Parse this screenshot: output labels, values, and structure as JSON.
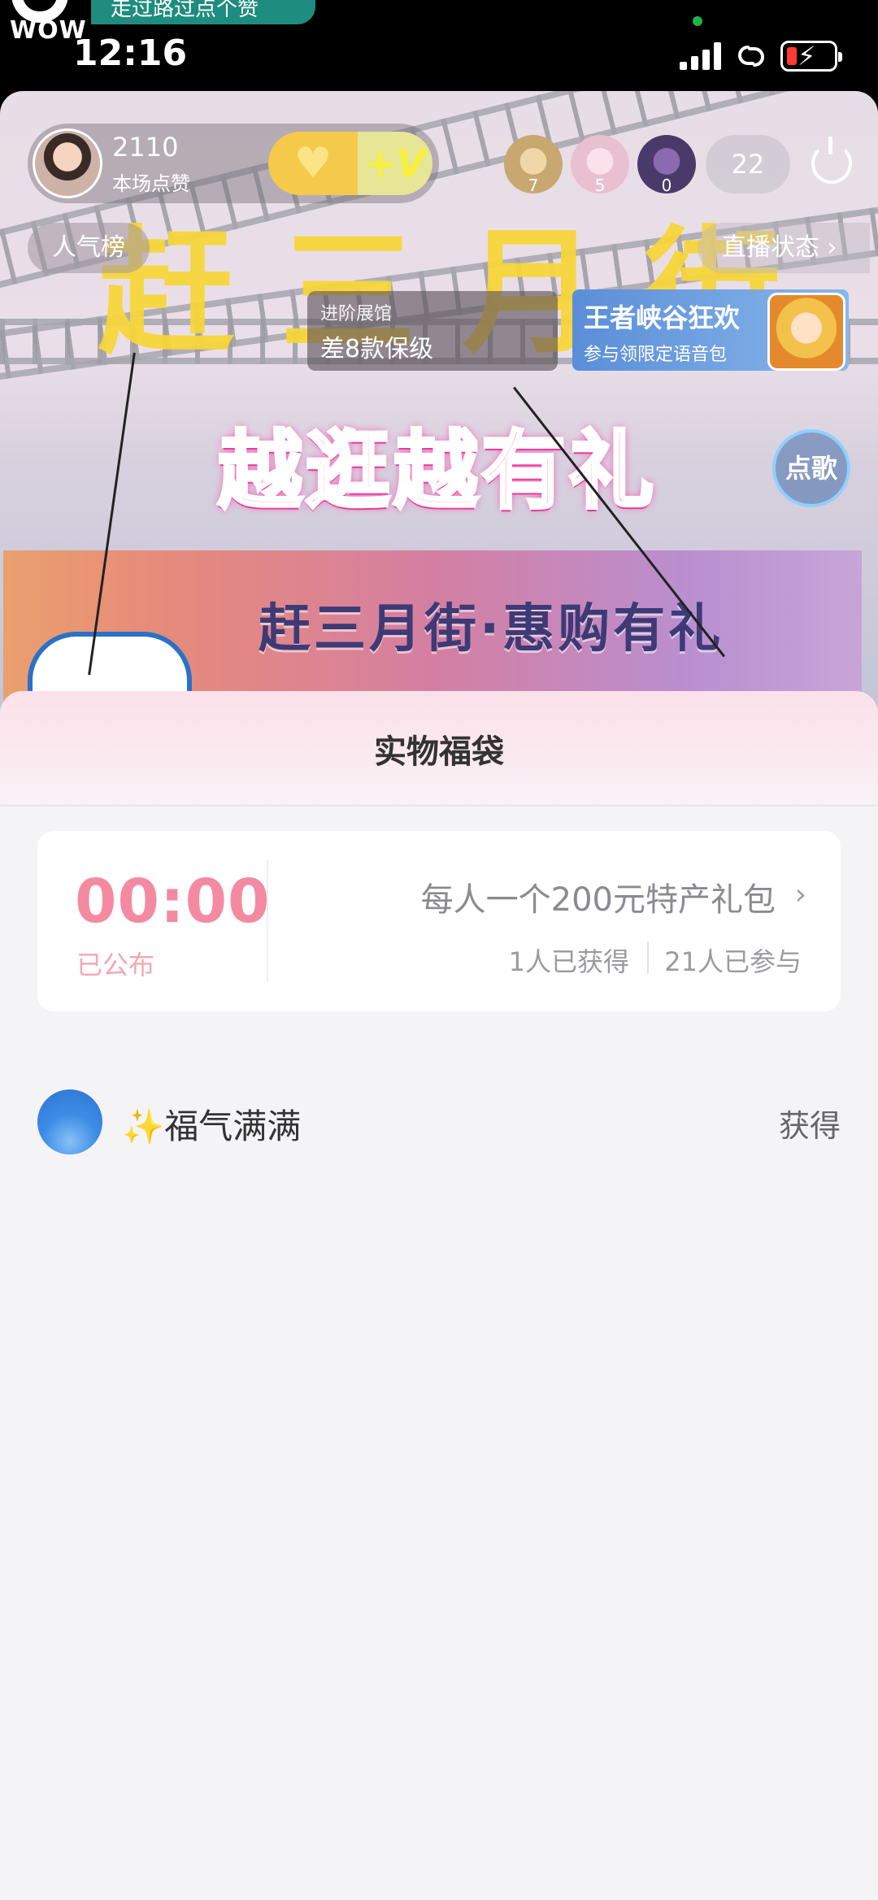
{
  "status_bar": {
    "banner": "WOW",
    "top_banner_text": "走过路过点个赞",
    "time": "12:16"
  },
  "live": {
    "host": {
      "likes": "2110",
      "likes_label": "本场点赞"
    },
    "follow": {
      "plus_v": "+V"
    },
    "viewers": [
      {
        "count": "7",
        "color": "#c8a870"
      },
      {
        "count": "5",
        "color": "#e8c0d0"
      },
      {
        "count": "0",
        "color": "#4a3a6a"
      }
    ],
    "viewer_total": "22",
    "rank_label": "人气榜",
    "status_label": "直播状态",
    "exhibit": {
      "title": "进阶展馆",
      "detail": "差8款保级"
    },
    "game_banner": {
      "title": "王者峡谷狂欢",
      "subtitle": "参与领限定语音包"
    },
    "song_label": "点歌",
    "stage_title": "赶三月街",
    "stage_subtitle": "越逛越有礼",
    "board_text": "赶三月街·惠购有礼"
  },
  "sheet": {
    "title": "实物福袋",
    "countdown": "00:00",
    "countdown_status": "已公布",
    "prize": "每人一个200元特产礼包",
    "winners_count": "1人已获得",
    "participants_count": "21人已参与",
    "winner": {
      "spark": "✨",
      "name": "福气满满",
      "status": "获得"
    }
  }
}
